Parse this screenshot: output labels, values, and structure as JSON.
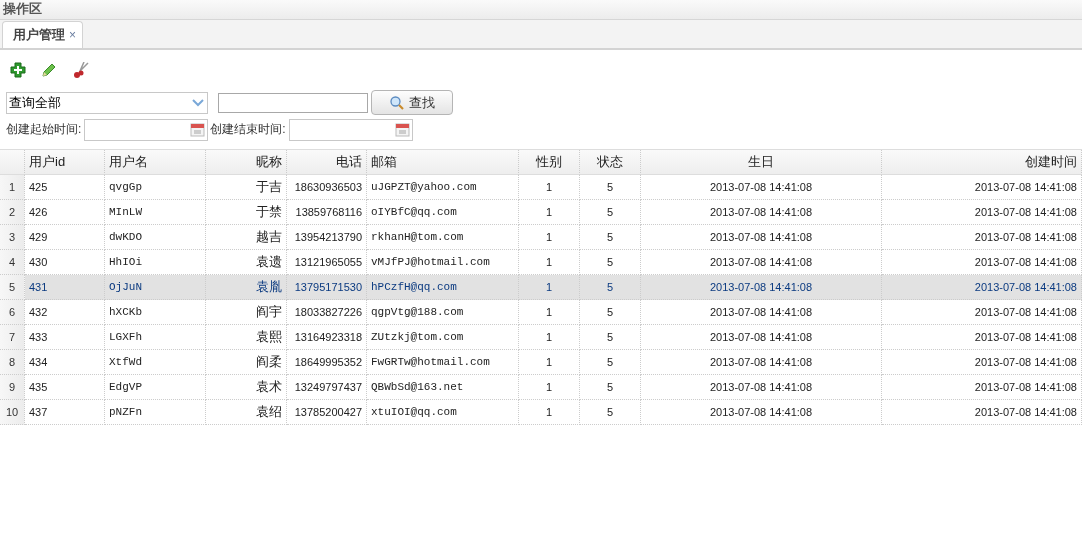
{
  "panel": {
    "title": "操作区"
  },
  "tabs": [
    {
      "label": "用户管理",
      "close": "×",
      "selected": true
    }
  ],
  "toolbar": [
    {
      "kind": "add"
    },
    {
      "kind": "edit"
    },
    {
      "kind": "cut"
    }
  ],
  "search": {
    "query_type": "查询全部",
    "button": "查找",
    "start_label": "创建起始时间:",
    "end_label": "创建结束时间:"
  },
  "table": {
    "columns": [
      "用户id",
      "用户名",
      "昵称",
      "电话",
      "邮箱",
      "性别",
      "状态",
      "生日",
      "创建时间"
    ],
    "rows": [
      {
        "number": "1",
        "selected": false,
        "cells": [
          "425",
          "qvgGp",
          "于吉",
          "18630936503",
          "uJGPZT@yahoo.com",
          "1",
          "5",
          "2013-07-08 14:41:08",
          "2013-07-08 14:41:08"
        ]
      },
      {
        "number": "2",
        "selected": false,
        "cells": [
          "426",
          "MInLW",
          "于禁",
          "13859768116",
          "oIYBfC@qq.com",
          "1",
          "5",
          "2013-07-08 14:41:08",
          "2013-07-08 14:41:08"
        ]
      },
      {
        "number": "3",
        "selected": false,
        "cells": [
          "429",
          "dwKDO",
          "越吉",
          "13954213790",
          "rkhanH@tom.com",
          "1",
          "5",
          "2013-07-08 14:41:08",
          "2013-07-08 14:41:08"
        ]
      },
      {
        "number": "4",
        "selected": false,
        "cells": [
          "430",
          "HhIOi",
          "袁遗",
          "13121965055",
          "vMJfPJ@hotmail.com",
          "1",
          "5",
          "2013-07-08 14:41:08",
          "2013-07-08 14:41:08"
        ]
      },
      {
        "number": "5",
        "selected": true,
        "cells": [
          "431",
          "OjJuN",
          "袁胤",
          "13795171530",
          "hPCzfH@qq.com",
          "1",
          "5",
          "2013-07-08 14:41:08",
          "2013-07-08 14:41:08"
        ]
      },
      {
        "number": "6",
        "selected": false,
        "cells": [
          "432",
          "hXCKb",
          "阎宇",
          "18033827226",
          "qgpVtg@188.com",
          "1",
          "5",
          "2013-07-08 14:41:08",
          "2013-07-08 14:41:08"
        ]
      },
      {
        "number": "7",
        "selected": false,
        "cells": [
          "433",
          "LGXFh",
          "袁熙",
          "13164923318",
          "ZUtzkj@tom.com",
          "1",
          "5",
          "2013-07-08 14:41:08",
          "2013-07-08 14:41:08"
        ]
      },
      {
        "number": "8",
        "selected": false,
        "cells": [
          "434",
          "XtfWd",
          "阎柔",
          "18649995352",
          "FwGRTw@hotmail.com",
          "1",
          "5",
          "2013-07-08 14:41:08",
          "2013-07-08 14:41:08"
        ]
      },
      {
        "number": "9",
        "selected": false,
        "cells": [
          "435",
          "EdgVP",
          "袁术",
          "13249797437",
          "QBWbSd@163.net",
          "1",
          "5",
          "2013-07-08 14:41:08",
          "2013-07-08 14:41:08"
        ]
      },
      {
        "number": "10",
        "selected": false,
        "cells": [
          "437",
          "pNZFn",
          "袁绍",
          "13785200427",
          "xtuIOI@qq.com",
          "1",
          "5",
          "2013-07-08 14:41:08",
          "2013-07-08 14:41:08"
        ]
      }
    ]
  }
}
